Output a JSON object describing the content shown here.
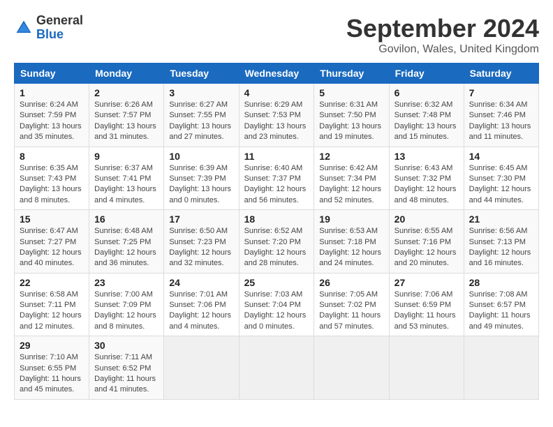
{
  "logo": {
    "general": "General",
    "blue": "Blue"
  },
  "title": "September 2024",
  "location": "Govilon, Wales, United Kingdom",
  "headers": [
    "Sunday",
    "Monday",
    "Tuesday",
    "Wednesday",
    "Thursday",
    "Friday",
    "Saturday"
  ],
  "weeks": [
    [
      {
        "day": "1",
        "sunrise": "6:24 AM",
        "sunset": "7:59 PM",
        "daylight": "13 hours and 35 minutes."
      },
      {
        "day": "2",
        "sunrise": "6:26 AM",
        "sunset": "7:57 PM",
        "daylight": "13 hours and 31 minutes."
      },
      {
        "day": "3",
        "sunrise": "6:27 AM",
        "sunset": "7:55 PM",
        "daylight": "13 hours and 27 minutes."
      },
      {
        "day": "4",
        "sunrise": "6:29 AM",
        "sunset": "7:53 PM",
        "daylight": "13 hours and 23 minutes."
      },
      {
        "day": "5",
        "sunrise": "6:31 AM",
        "sunset": "7:50 PM",
        "daylight": "13 hours and 19 minutes."
      },
      {
        "day": "6",
        "sunrise": "6:32 AM",
        "sunset": "7:48 PM",
        "daylight": "13 hours and 15 minutes."
      },
      {
        "day": "7",
        "sunrise": "6:34 AM",
        "sunset": "7:46 PM",
        "daylight": "13 hours and 11 minutes."
      }
    ],
    [
      {
        "day": "8",
        "sunrise": "6:35 AM",
        "sunset": "7:43 PM",
        "daylight": "13 hours and 8 minutes."
      },
      {
        "day": "9",
        "sunrise": "6:37 AM",
        "sunset": "7:41 PM",
        "daylight": "13 hours and 4 minutes."
      },
      {
        "day": "10",
        "sunrise": "6:39 AM",
        "sunset": "7:39 PM",
        "daylight": "13 hours and 0 minutes."
      },
      {
        "day": "11",
        "sunrise": "6:40 AM",
        "sunset": "7:37 PM",
        "daylight": "12 hours and 56 minutes."
      },
      {
        "day": "12",
        "sunrise": "6:42 AM",
        "sunset": "7:34 PM",
        "daylight": "12 hours and 52 minutes."
      },
      {
        "day": "13",
        "sunrise": "6:43 AM",
        "sunset": "7:32 PM",
        "daylight": "12 hours and 48 minutes."
      },
      {
        "day": "14",
        "sunrise": "6:45 AM",
        "sunset": "7:30 PM",
        "daylight": "12 hours and 44 minutes."
      }
    ],
    [
      {
        "day": "15",
        "sunrise": "6:47 AM",
        "sunset": "7:27 PM",
        "daylight": "12 hours and 40 minutes."
      },
      {
        "day": "16",
        "sunrise": "6:48 AM",
        "sunset": "7:25 PM",
        "daylight": "12 hours and 36 minutes."
      },
      {
        "day": "17",
        "sunrise": "6:50 AM",
        "sunset": "7:23 PM",
        "daylight": "12 hours and 32 minutes."
      },
      {
        "day": "18",
        "sunrise": "6:52 AM",
        "sunset": "7:20 PM",
        "daylight": "12 hours and 28 minutes."
      },
      {
        "day": "19",
        "sunrise": "6:53 AM",
        "sunset": "7:18 PM",
        "daylight": "12 hours and 24 minutes."
      },
      {
        "day": "20",
        "sunrise": "6:55 AM",
        "sunset": "7:16 PM",
        "daylight": "12 hours and 20 minutes."
      },
      {
        "day": "21",
        "sunrise": "6:56 AM",
        "sunset": "7:13 PM",
        "daylight": "12 hours and 16 minutes."
      }
    ],
    [
      {
        "day": "22",
        "sunrise": "6:58 AM",
        "sunset": "7:11 PM",
        "daylight": "12 hours and 12 minutes."
      },
      {
        "day": "23",
        "sunrise": "7:00 AM",
        "sunset": "7:09 PM",
        "daylight": "12 hours and 8 minutes."
      },
      {
        "day": "24",
        "sunrise": "7:01 AM",
        "sunset": "7:06 PM",
        "daylight": "12 hours and 4 minutes."
      },
      {
        "day": "25",
        "sunrise": "7:03 AM",
        "sunset": "7:04 PM",
        "daylight": "12 hours and 0 minutes."
      },
      {
        "day": "26",
        "sunrise": "7:05 AM",
        "sunset": "7:02 PM",
        "daylight": "11 hours and 57 minutes."
      },
      {
        "day": "27",
        "sunrise": "7:06 AM",
        "sunset": "6:59 PM",
        "daylight": "11 hours and 53 minutes."
      },
      {
        "day": "28",
        "sunrise": "7:08 AM",
        "sunset": "6:57 PM",
        "daylight": "11 hours and 49 minutes."
      }
    ],
    [
      {
        "day": "29",
        "sunrise": "7:10 AM",
        "sunset": "6:55 PM",
        "daylight": "11 hours and 45 minutes."
      },
      {
        "day": "30",
        "sunrise": "7:11 AM",
        "sunset": "6:52 PM",
        "daylight": "11 hours and 41 minutes."
      },
      null,
      null,
      null,
      null,
      null
    ]
  ]
}
